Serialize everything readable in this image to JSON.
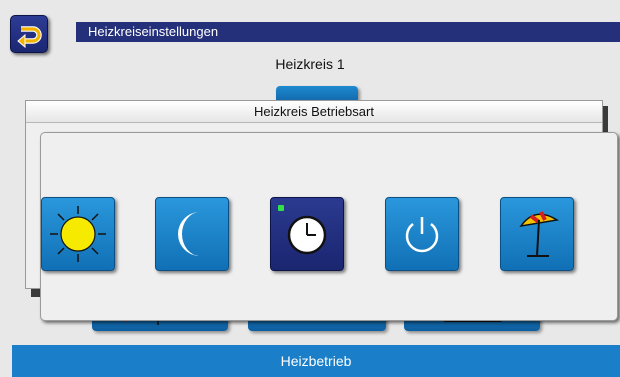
{
  "header": {
    "title": "Heizkreiseinstellungen",
    "back_icon": "back-arrow-icon"
  },
  "subtitle": "Heizkreis 1",
  "dialog": {
    "title": "Heizkreis Betriebsart",
    "back_icon": "back-arrow-icon",
    "modes": [
      {
        "icon": "sun-icon",
        "selected": false
      },
      {
        "icon": "moon-icon",
        "selected": false
      },
      {
        "icon": "clock-icon",
        "selected": true
      },
      {
        "icon": "power-icon",
        "selected": false
      },
      {
        "icon": "beach-umbrella-icon",
        "selected": false
      }
    ]
  },
  "background_tiles": [
    {
      "icon": "heating-curve-icon"
    },
    {
      "icon": "gears-icon"
    },
    {
      "icon": "floor-heating-icon"
    }
  ],
  "footer": {
    "label": "Heizbetrieb"
  },
  "colors": {
    "header": "#25307a",
    "footer": "#1a7fc8",
    "tile": "#1a80c6",
    "selected_tile": "#1f2b78",
    "indicator": "#33e04a",
    "sun": "#f5ea00",
    "arrow": "#f2b300"
  }
}
